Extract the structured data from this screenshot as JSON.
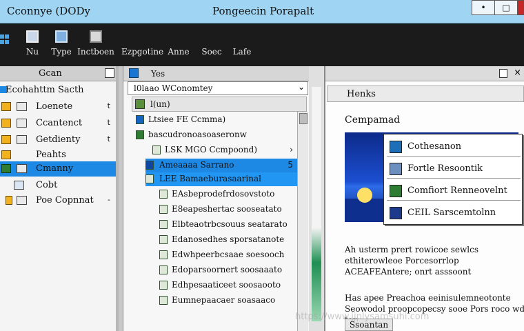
{
  "titlebar": {
    "app_title": "Cconnye (DODy",
    "window_title": "Pongeecin Porapalt",
    "min_label": "•",
    "max_label": "□",
    "close_label": "×"
  },
  "toolbar": {
    "items": [
      {
        "label": "Nu",
        "icon": "folder-icon",
        "color": "#c9d7e8"
      },
      {
        "label": "Type",
        "icon": "document-icon",
        "color": "#7fb0e0"
      },
      {
        "label": "Inctboen",
        "icon": "window-icon",
        "color": "#d9d9d9"
      },
      {
        "label": "Ezpgotine",
        "icon": "blank-icon",
        "color": "#1b1b1b"
      },
      {
        "label": "Anne",
        "icon": "blank-icon",
        "color": "#1b1b1b"
      },
      {
        "label": "Soec",
        "icon": "blank-icon",
        "color": "#1b1b1b"
      },
      {
        "label": "Lafe",
        "icon": "blank-icon",
        "color": "#1b1b1b"
      }
    ]
  },
  "leftpane": {
    "header": "Gcan",
    "items": [
      {
        "label": "Ecohahttm Sacth",
        "caret": "",
        "folder": false,
        "doc": false
      },
      {
        "label": "Loenete",
        "caret": "t",
        "folder": true,
        "doc": true
      },
      {
        "label": "Ccantenct",
        "caret": "t",
        "folder": true,
        "doc": true
      },
      {
        "label": "Getdienty",
        "caret": "t",
        "folder": true,
        "doc": true
      },
      {
        "label": "Peahts",
        "caret": "",
        "folder": true,
        "doc": false
      },
      {
        "label": "Cmanny",
        "caret": "",
        "folder": true,
        "doc": true
      },
      {
        "label": "Cobt",
        "caret": "",
        "folder": false,
        "doc": true
      },
      {
        "label": "Poe Copnnat",
        "caret": "-",
        "folder": true,
        "doc": true
      }
    ],
    "selected_index": 5
  },
  "midpane": {
    "top_label": "Yes",
    "address": "l0laao WConomtey",
    "crumb": "l(un)",
    "list": [
      {
        "label": "Ltsiee FE Ccmma)",
        "indent": 0,
        "sel": ""
      },
      {
        "label": "bascudronoasoaseronw",
        "indent": 1,
        "sel": ""
      },
      {
        "label": "LSK MGO Ccmpoond)",
        "indent": 2,
        "sel": "",
        "mark": "›"
      },
      {
        "label": "Ameaaaa Sarrano",
        "indent": 2,
        "sel": "sel1",
        "mark": "5"
      },
      {
        "label": "LEE Bamaeburasaarinal",
        "indent": 2,
        "sel": "sel2",
        "mark": ""
      },
      {
        "label": "EAsbeprodefrdosovstoto",
        "indent": 2,
        "sel": ""
      },
      {
        "label": "E8eapeshertac sooseatato",
        "indent": 2,
        "sel": ""
      },
      {
        "label": "Elbteaotrbcsouus seatarato",
        "indent": 2,
        "sel": ""
      },
      {
        "label": "Edanosedhes sporsatanote",
        "indent": 2,
        "sel": ""
      },
      {
        "label": "Edwhpeerbcsaae soesooch",
        "indent": 2,
        "sel": ""
      },
      {
        "label": "Edoparsoornert soosaaato",
        "indent": 2,
        "sel": ""
      },
      {
        "label": "Edhpesaaticeet soosaooto",
        "indent": 2,
        "sel": ""
      },
      {
        "label": "Eumnepaacaer soasaaco",
        "indent": 2,
        "sel": ""
      }
    ]
  },
  "rightpane": {
    "tab": "Henks",
    "heading": "Cempamad",
    "popup_items": [
      {
        "label": "Cothesanon",
        "color": "#1f6fb8"
      },
      {
        "label": "Fortle Resoontik",
        "color": "#6c8fbf"
      },
      {
        "label": "Comfiort Renneovelnt",
        "color": "#2e7d32"
      },
      {
        "label": "CEIL Sarscemtolnn",
        "color": "#1e3a8a"
      }
    ],
    "para1": "Ah usterm prert rowicoe sewlcs ethiterowleoe Porcesorrlop ACEAFEAntere; onrt asssoont",
    "para2": "Has apee Preachoa eeinisulemneotonte Seowodol proopcopecsy sooe Pors roco wd tan",
    "footer_btn": "Ssoantan"
  },
  "watermark": "https://www.jjplysamsuhi.com"
}
